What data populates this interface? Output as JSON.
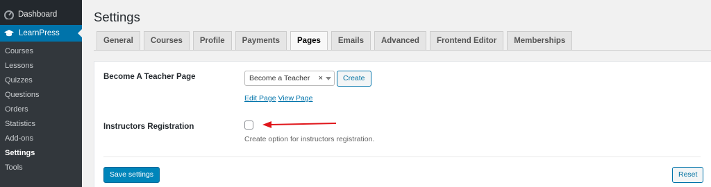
{
  "sidebar": {
    "dashboard_label": "Dashboard",
    "plugin_label": "LearnPress",
    "items": [
      {
        "label": "Courses"
      },
      {
        "label": "Lessons"
      },
      {
        "label": "Quizzes"
      },
      {
        "label": "Questions"
      },
      {
        "label": "Orders"
      },
      {
        "label": "Statistics"
      },
      {
        "label": "Add-ons"
      },
      {
        "label": "Settings"
      },
      {
        "label": "Tools"
      }
    ],
    "current": "Settings"
  },
  "page": {
    "title": "Settings"
  },
  "tabs": [
    {
      "label": "General"
    },
    {
      "label": "Courses"
    },
    {
      "label": "Profile"
    },
    {
      "label": "Payments"
    },
    {
      "label": "Pages"
    },
    {
      "label": "Emails"
    },
    {
      "label": "Advanced"
    },
    {
      "label": "Frontend Editor"
    },
    {
      "label": "Memberships"
    }
  ],
  "active_tab": "Pages",
  "settings": {
    "teacher_page": {
      "label": "Become A Teacher Page",
      "selected": "Become a Teacher",
      "clear_symbol": "×",
      "create_label": "Create",
      "edit_link": "Edit Page",
      "view_link": "View Page"
    },
    "instructors_registration": {
      "label": "Instructors Registration",
      "checked": false,
      "description": "Create option for instructors registration."
    }
  },
  "actions": {
    "save_label": "Save settings",
    "reset_label": "Reset"
  },
  "colors": {
    "sidebar_bg": "#23282d",
    "accent": "#0073aa",
    "arrow": "#e0161b"
  }
}
